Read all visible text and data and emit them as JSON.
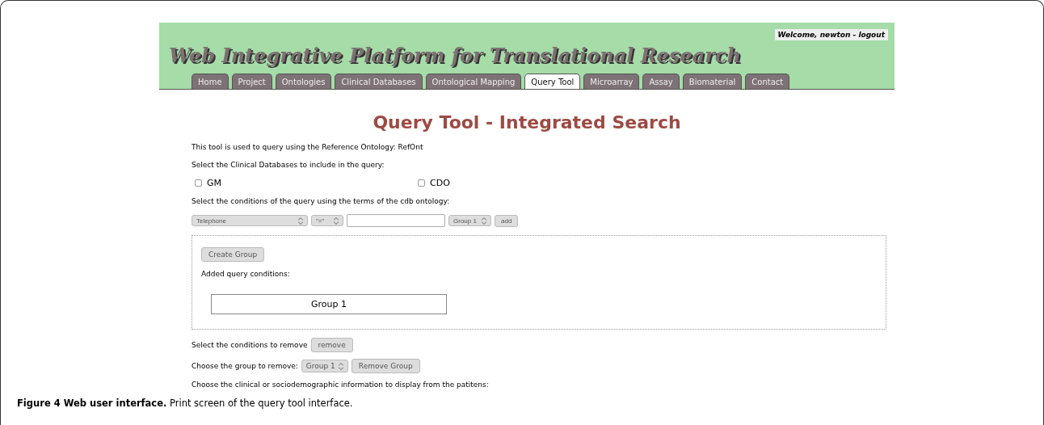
{
  "header": {
    "title": "Web Integrative Platform for Translational Research",
    "welcome": "Welcome, newton - logout"
  },
  "tabs": [
    {
      "label": "Home",
      "selected": false
    },
    {
      "label": "Project",
      "selected": false
    },
    {
      "label": "Ontologies",
      "selected": false
    },
    {
      "label": "Clinical Databases",
      "selected": false
    },
    {
      "label": "Ontological Mapping",
      "selected": false
    },
    {
      "label": "Query Tool",
      "selected": true
    },
    {
      "label": "Microarray",
      "selected": false
    },
    {
      "label": "Assay",
      "selected": false
    },
    {
      "label": "Biomaterial",
      "selected": false
    },
    {
      "label": "Contact",
      "selected": false
    }
  ],
  "heading": "Query Tool - Integrated Search",
  "intro": "This tool is used to query using the Reference Ontology: RefOnt",
  "databases_label": "Select the Clinical Databases to include in the query:",
  "databases": [
    {
      "label": "GM",
      "checked": false
    },
    {
      "label": "CDO",
      "checked": false
    }
  ],
  "conditions_label": "Select the conditions of the query using the terms of the cdb ontology:",
  "condition_row": {
    "term": "Telephone",
    "operator": "\"=\"",
    "group": "Group 1",
    "add": "add"
  },
  "group_panel": {
    "create": "Create Group",
    "added_label": "Added query conditions:",
    "groups": [
      "Group 1"
    ]
  },
  "remove_label": "Select the conditions to remove",
  "remove_button": "remove",
  "group_remove_label": "Choose the group to remove:",
  "group_remove_select": "Group 1",
  "remove_group_button": "Remove Group",
  "display_label": "Choose the clinical or sociodemographic information to display from the patitens:",
  "caption": "**Figure 4 Web user interface.** Print screen of the query tool interface."
}
